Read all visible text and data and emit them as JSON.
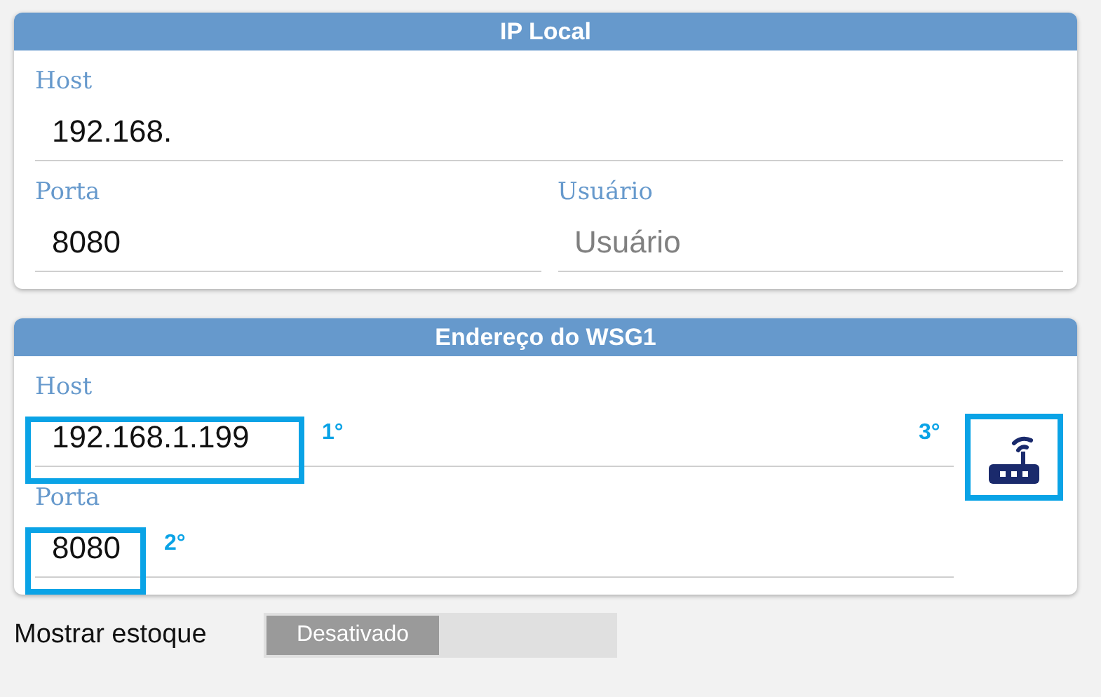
{
  "sections": [
    {
      "title": "IP Local",
      "rows": [
        [
          {
            "label": "Host",
            "value": "192.168."
          }
        ],
        [
          {
            "label": "Porta",
            "value": "8080"
          },
          {
            "label": "Usuário",
            "placeholder": "Usuário"
          }
        ]
      ]
    },
    {
      "title": "Endereço do WSG1",
      "scan_button": {
        "highlighted": true,
        "callout": "3°"
      },
      "rows": [
        [
          {
            "label": "Host",
            "value": "192.168.1.199",
            "highlighted": true,
            "callout": "1°"
          }
        ],
        [
          {
            "label": "Porta",
            "value": "8080",
            "highlighted": true,
            "callout": "2°"
          }
        ]
      ]
    }
  ],
  "stock_toggle": {
    "label": "Mostrar estoque",
    "state_text": "Desativado",
    "on": false
  }
}
